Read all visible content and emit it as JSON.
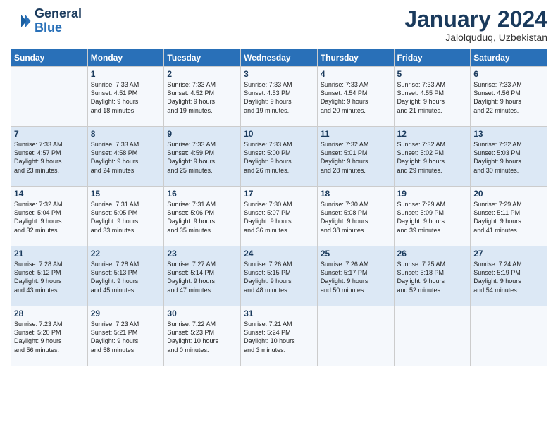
{
  "header": {
    "logo_line1": "General",
    "logo_line2": "Blue",
    "month_title": "January 2024",
    "location": "Jalolquduq, Uzbekistan"
  },
  "weekdays": [
    "Sunday",
    "Monday",
    "Tuesday",
    "Wednesday",
    "Thursday",
    "Friday",
    "Saturday"
  ],
  "weeks": [
    [
      {
        "day": "",
        "lines": []
      },
      {
        "day": "1",
        "lines": [
          "Sunrise: 7:33 AM",
          "Sunset: 4:51 PM",
          "Daylight: 9 hours",
          "and 18 minutes."
        ]
      },
      {
        "day": "2",
        "lines": [
          "Sunrise: 7:33 AM",
          "Sunset: 4:52 PM",
          "Daylight: 9 hours",
          "and 19 minutes."
        ]
      },
      {
        "day": "3",
        "lines": [
          "Sunrise: 7:33 AM",
          "Sunset: 4:53 PM",
          "Daylight: 9 hours",
          "and 19 minutes."
        ]
      },
      {
        "day": "4",
        "lines": [
          "Sunrise: 7:33 AM",
          "Sunset: 4:54 PM",
          "Daylight: 9 hours",
          "and 20 minutes."
        ]
      },
      {
        "day": "5",
        "lines": [
          "Sunrise: 7:33 AM",
          "Sunset: 4:55 PM",
          "Daylight: 9 hours",
          "and 21 minutes."
        ]
      },
      {
        "day": "6",
        "lines": [
          "Sunrise: 7:33 AM",
          "Sunset: 4:56 PM",
          "Daylight: 9 hours",
          "and 22 minutes."
        ]
      }
    ],
    [
      {
        "day": "7",
        "lines": [
          "Sunrise: 7:33 AM",
          "Sunset: 4:57 PM",
          "Daylight: 9 hours",
          "and 23 minutes."
        ]
      },
      {
        "day": "8",
        "lines": [
          "Sunrise: 7:33 AM",
          "Sunset: 4:58 PM",
          "Daylight: 9 hours",
          "and 24 minutes."
        ]
      },
      {
        "day": "9",
        "lines": [
          "Sunrise: 7:33 AM",
          "Sunset: 4:59 PM",
          "Daylight: 9 hours",
          "and 25 minutes."
        ]
      },
      {
        "day": "10",
        "lines": [
          "Sunrise: 7:33 AM",
          "Sunset: 5:00 PM",
          "Daylight: 9 hours",
          "and 26 minutes."
        ]
      },
      {
        "day": "11",
        "lines": [
          "Sunrise: 7:32 AM",
          "Sunset: 5:01 PM",
          "Daylight: 9 hours",
          "and 28 minutes."
        ]
      },
      {
        "day": "12",
        "lines": [
          "Sunrise: 7:32 AM",
          "Sunset: 5:02 PM",
          "Daylight: 9 hours",
          "and 29 minutes."
        ]
      },
      {
        "day": "13",
        "lines": [
          "Sunrise: 7:32 AM",
          "Sunset: 5:03 PM",
          "Daylight: 9 hours",
          "and 30 minutes."
        ]
      }
    ],
    [
      {
        "day": "14",
        "lines": [
          "Sunrise: 7:32 AM",
          "Sunset: 5:04 PM",
          "Daylight: 9 hours",
          "and 32 minutes."
        ]
      },
      {
        "day": "15",
        "lines": [
          "Sunrise: 7:31 AM",
          "Sunset: 5:05 PM",
          "Daylight: 9 hours",
          "and 33 minutes."
        ]
      },
      {
        "day": "16",
        "lines": [
          "Sunrise: 7:31 AM",
          "Sunset: 5:06 PM",
          "Daylight: 9 hours",
          "and 35 minutes."
        ]
      },
      {
        "day": "17",
        "lines": [
          "Sunrise: 7:30 AM",
          "Sunset: 5:07 PM",
          "Daylight: 9 hours",
          "and 36 minutes."
        ]
      },
      {
        "day": "18",
        "lines": [
          "Sunrise: 7:30 AM",
          "Sunset: 5:08 PM",
          "Daylight: 9 hours",
          "and 38 minutes."
        ]
      },
      {
        "day": "19",
        "lines": [
          "Sunrise: 7:29 AM",
          "Sunset: 5:09 PM",
          "Daylight: 9 hours",
          "and 39 minutes."
        ]
      },
      {
        "day": "20",
        "lines": [
          "Sunrise: 7:29 AM",
          "Sunset: 5:11 PM",
          "Daylight: 9 hours",
          "and 41 minutes."
        ]
      }
    ],
    [
      {
        "day": "21",
        "lines": [
          "Sunrise: 7:28 AM",
          "Sunset: 5:12 PM",
          "Daylight: 9 hours",
          "and 43 minutes."
        ]
      },
      {
        "day": "22",
        "lines": [
          "Sunrise: 7:28 AM",
          "Sunset: 5:13 PM",
          "Daylight: 9 hours",
          "and 45 minutes."
        ]
      },
      {
        "day": "23",
        "lines": [
          "Sunrise: 7:27 AM",
          "Sunset: 5:14 PM",
          "Daylight: 9 hours",
          "and 47 minutes."
        ]
      },
      {
        "day": "24",
        "lines": [
          "Sunrise: 7:26 AM",
          "Sunset: 5:15 PM",
          "Daylight: 9 hours",
          "and 48 minutes."
        ]
      },
      {
        "day": "25",
        "lines": [
          "Sunrise: 7:26 AM",
          "Sunset: 5:17 PM",
          "Daylight: 9 hours",
          "and 50 minutes."
        ]
      },
      {
        "day": "26",
        "lines": [
          "Sunrise: 7:25 AM",
          "Sunset: 5:18 PM",
          "Daylight: 9 hours",
          "and 52 minutes."
        ]
      },
      {
        "day": "27",
        "lines": [
          "Sunrise: 7:24 AM",
          "Sunset: 5:19 PM",
          "Daylight: 9 hours",
          "and 54 minutes."
        ]
      }
    ],
    [
      {
        "day": "28",
        "lines": [
          "Sunrise: 7:23 AM",
          "Sunset: 5:20 PM",
          "Daylight: 9 hours",
          "and 56 minutes."
        ]
      },
      {
        "day": "29",
        "lines": [
          "Sunrise: 7:23 AM",
          "Sunset: 5:21 PM",
          "Daylight: 9 hours",
          "and 58 minutes."
        ]
      },
      {
        "day": "30",
        "lines": [
          "Sunrise: 7:22 AM",
          "Sunset: 5:23 PM",
          "Daylight: 10 hours",
          "and 0 minutes."
        ]
      },
      {
        "day": "31",
        "lines": [
          "Sunrise: 7:21 AM",
          "Sunset: 5:24 PM",
          "Daylight: 10 hours",
          "and 3 minutes."
        ]
      },
      {
        "day": "",
        "lines": []
      },
      {
        "day": "",
        "lines": []
      },
      {
        "day": "",
        "lines": []
      }
    ]
  ]
}
